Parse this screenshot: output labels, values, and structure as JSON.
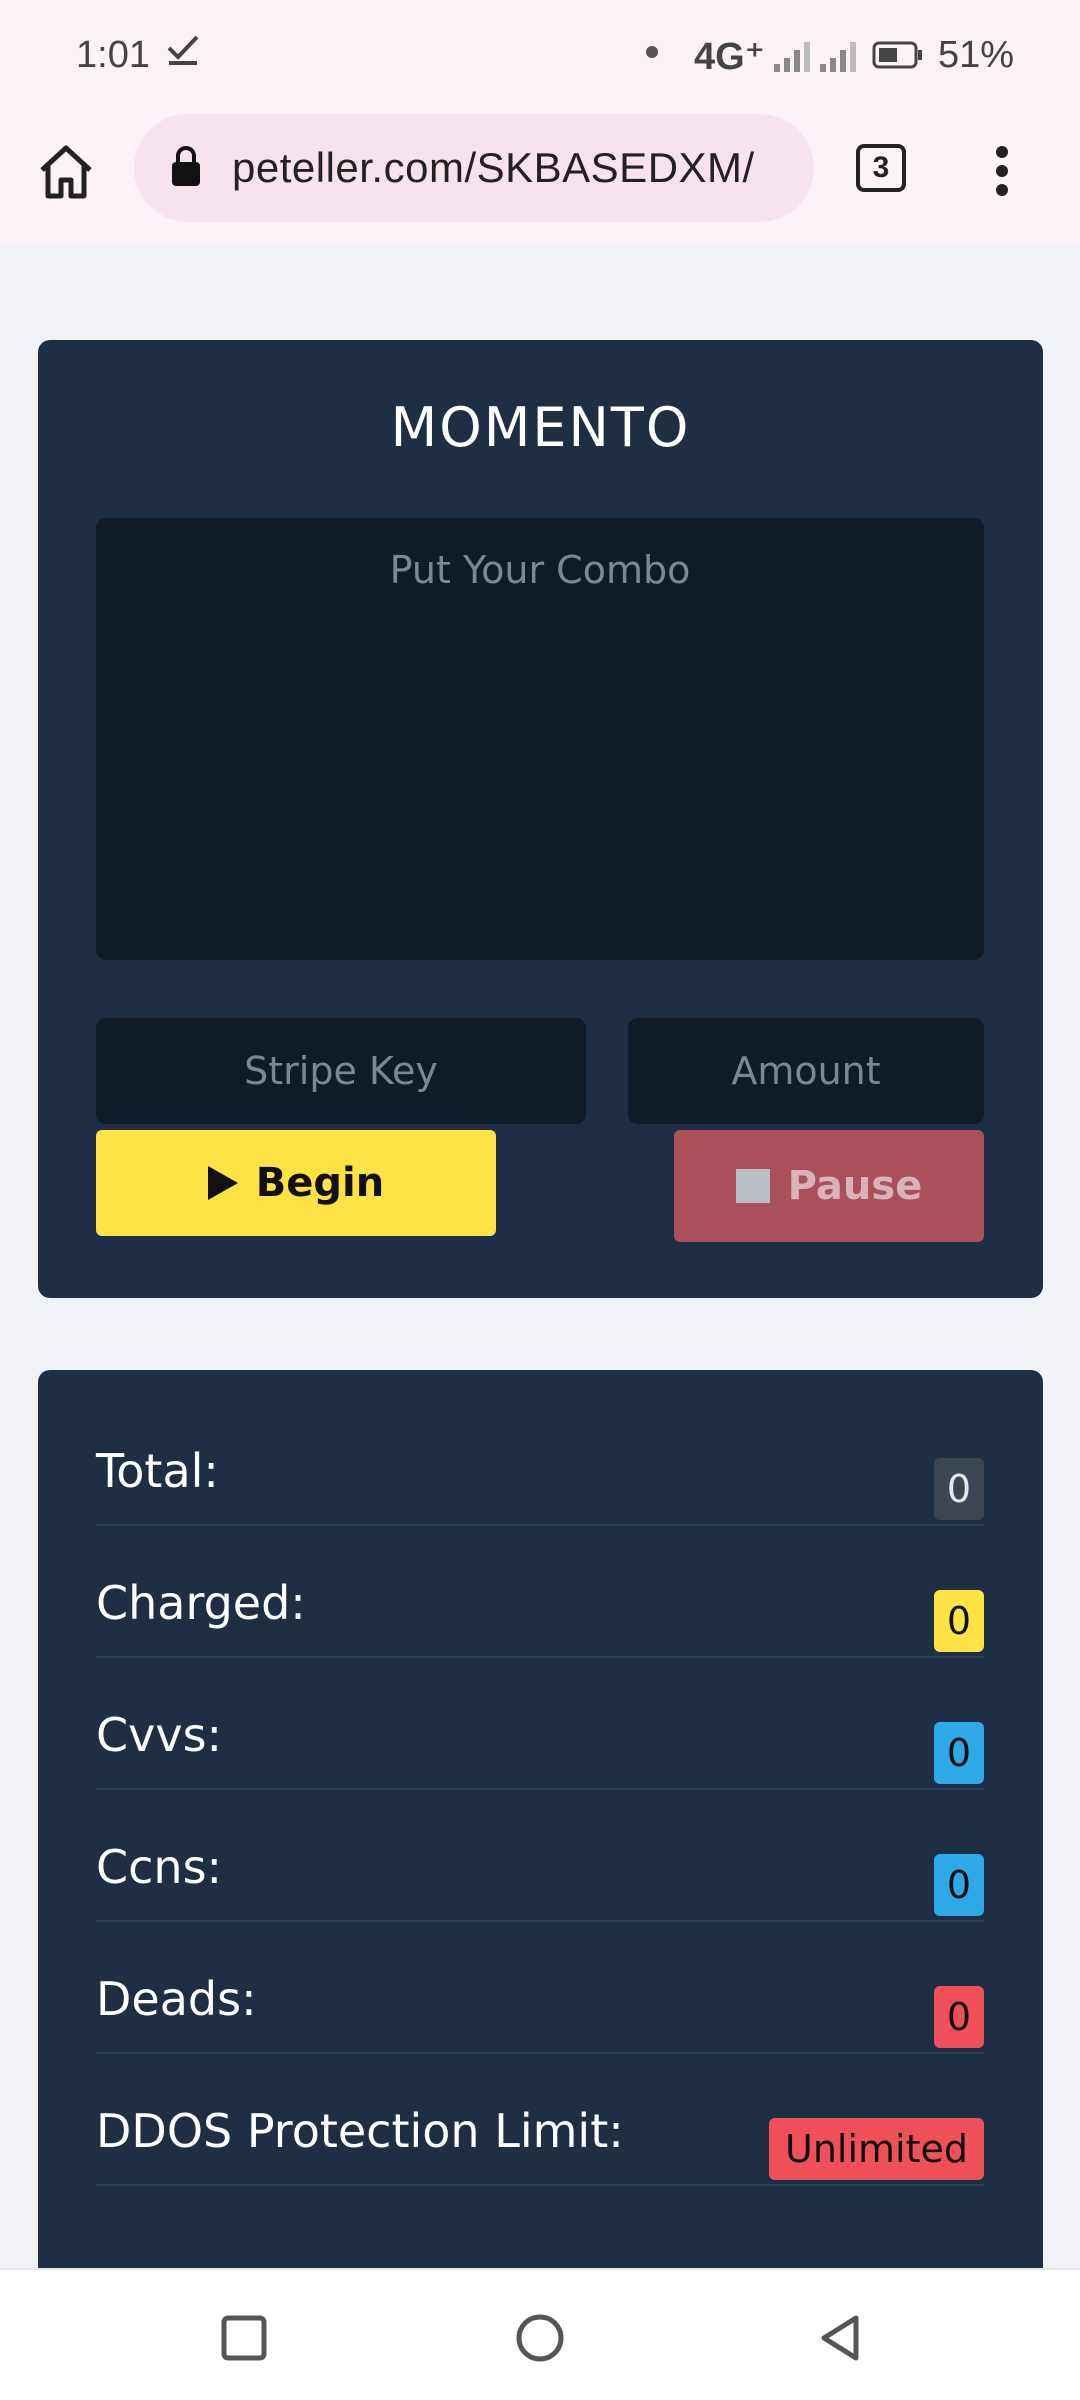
{
  "status_bar": {
    "time": "1:01",
    "network": "4G⁺",
    "battery": "51%"
  },
  "browser": {
    "url": "peteller.com/SKBASEDXM/",
    "tab_count": "3"
  },
  "checker": {
    "title": "MOMENTO",
    "combo_placeholder": "Put Your Combo",
    "stripe_key_placeholder": "Stripe Key",
    "amount_placeholder": "Amount",
    "begin_label": "Begin",
    "pause_label": "Pause"
  },
  "stats": {
    "total": {
      "label": "Total:",
      "value": "0"
    },
    "charged": {
      "label": "Charged:",
      "value": "0"
    },
    "cvvs": {
      "label": "Cvvs:",
      "value": "0"
    },
    "ccns": {
      "label": "Ccns:",
      "value": "0"
    },
    "deads": {
      "label": "Deads:",
      "value": "0"
    },
    "ddos": {
      "label": "DDOS Protection Limit:",
      "value": "Unlimited"
    }
  },
  "colors": {
    "card_bg": "#1e2f45",
    "accent_yellow": "#ffe345",
    "accent_blue": "#2ea8e6",
    "accent_red": "#f0505a",
    "pause_bg": "#a9505b"
  }
}
